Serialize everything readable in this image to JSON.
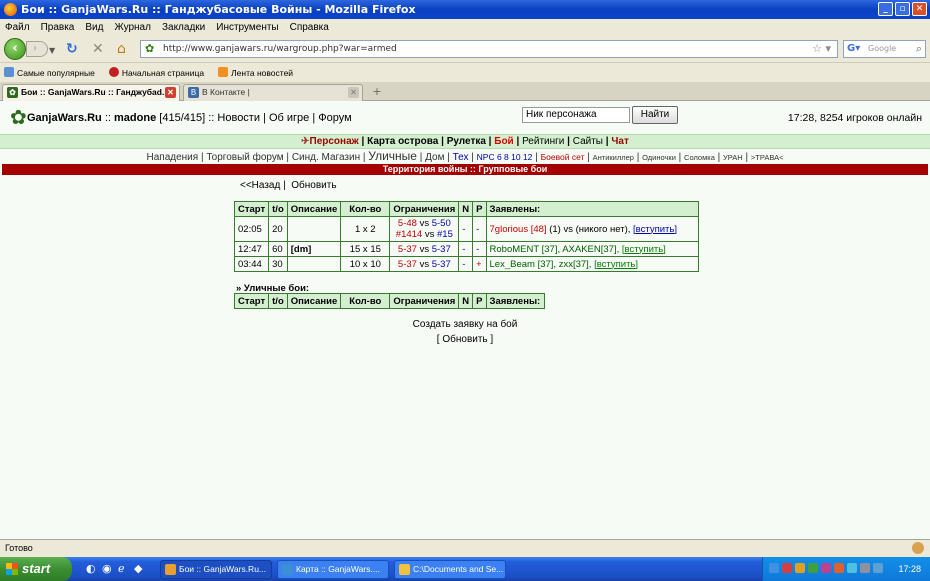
{
  "window": {
    "title": "Бои :: GanjaWars.Ru :: Ганджубасовые Войны - Mozilla Firefox"
  },
  "menu": [
    "Файл",
    "Правка",
    "Вид",
    "Журнал",
    "Закладки",
    "Инструменты",
    "Справка"
  ],
  "nav": {
    "url": "http://www.ganjawars.ru/wargroup.php?war=armed",
    "search_placeholder": "Google"
  },
  "bookmarks": [
    "Самые популярные",
    "Начальная страница",
    "Лента новостей"
  ],
  "tabs": [
    {
      "label": "Бои :: GanjaWars.Ru :: Ганджубаd...",
      "active": true
    },
    {
      "label": "В Контакте |",
      "active": false
    }
  ],
  "site": {
    "name": "GanjaWars.Ru",
    "sep1": "::",
    "user": "madone",
    "level": "[415/415]",
    "sep2": "::",
    "news": "Новости",
    "about": "Об игре",
    "forum": "Форум",
    "nick_placeholder": "Ник персонажа",
    "find_label": "Найти",
    "online": "17:28, 8254 игроков онлайн"
  },
  "main_menu": [
    "Персонаж",
    "Карта острова",
    "Рулетка",
    "Бой",
    "Рейтинги",
    "Сайты",
    "Чат"
  ],
  "sub_menu": {
    "attacks": "Нападения",
    "trade": "Торговый форум",
    "synd": "Синд. Магазин",
    "street": "Уличные",
    "home": "Дом",
    "tech": "Тех",
    "npc": "NPC 6 8 10 12",
    "combat": "Боевой сет",
    "anti": "Антикиллер",
    "single": "Одиночки",
    "straw": "Соломка",
    "uran": "УРАН",
    "grass": ">ТРАВА<"
  },
  "banner": "Территория войны :: Групповые бои",
  "links": {
    "back": "<<Назад",
    "refresh": "Обновить"
  },
  "table": {
    "headers": [
      "Старт",
      "t/o",
      "Описание",
      "Кол-во",
      "Ограничения",
      "N",
      "P",
      "Заявлены:"
    ],
    "rows": [
      {
        "start": "02:05",
        "to": "20",
        "desc": "",
        "count": "1 x 2",
        "lim_a": "5-48",
        "vs": "vs",
        "lim_b": "5-50",
        "lim_c": "#1414",
        "vs2": "vs",
        "lim_d": "#15",
        "n": "-",
        "p": "-",
        "who": "7glorious [48]",
        "who2": "(1) vs (никого нет),",
        "join": "[вступить]"
      },
      {
        "start": "12:47",
        "to": "60",
        "desc": "[dm]",
        "count": "15 x 15",
        "lim_a": "5-37",
        "vs": "vs",
        "lim_b": "5-37",
        "n": "-",
        "p": "-",
        "who": "RoboMENT [37], AXAKEN[37],",
        "join": "[вступить]"
      },
      {
        "start": "03:44",
        "to": "30",
        "desc": "",
        "count": "10 x 10",
        "lim_a": "5-37",
        "vs": "vs",
        "lim_b": "5-37",
        "n": "-",
        "p": "+",
        "who": "Lex_Beam [37], zxx[37],",
        "join": "[вступить]"
      }
    ]
  },
  "street_title": "» Уличные бои:",
  "street_headers": [
    "Старт",
    "t/o",
    "Описание",
    "Кол-во",
    "Ограничения",
    "N",
    "P",
    "Заявлены:"
  ],
  "create": "Создать заявку на бой",
  "refresh2": "[ Обновить ]",
  "status": "Готово",
  "taskbar": {
    "start": "start",
    "tasks": [
      "Бои :: GanjaWars.Ru...",
      "Карта :: GanjaWars....",
      "C:\\Documents and Se..."
    ],
    "clock": "17:28"
  }
}
